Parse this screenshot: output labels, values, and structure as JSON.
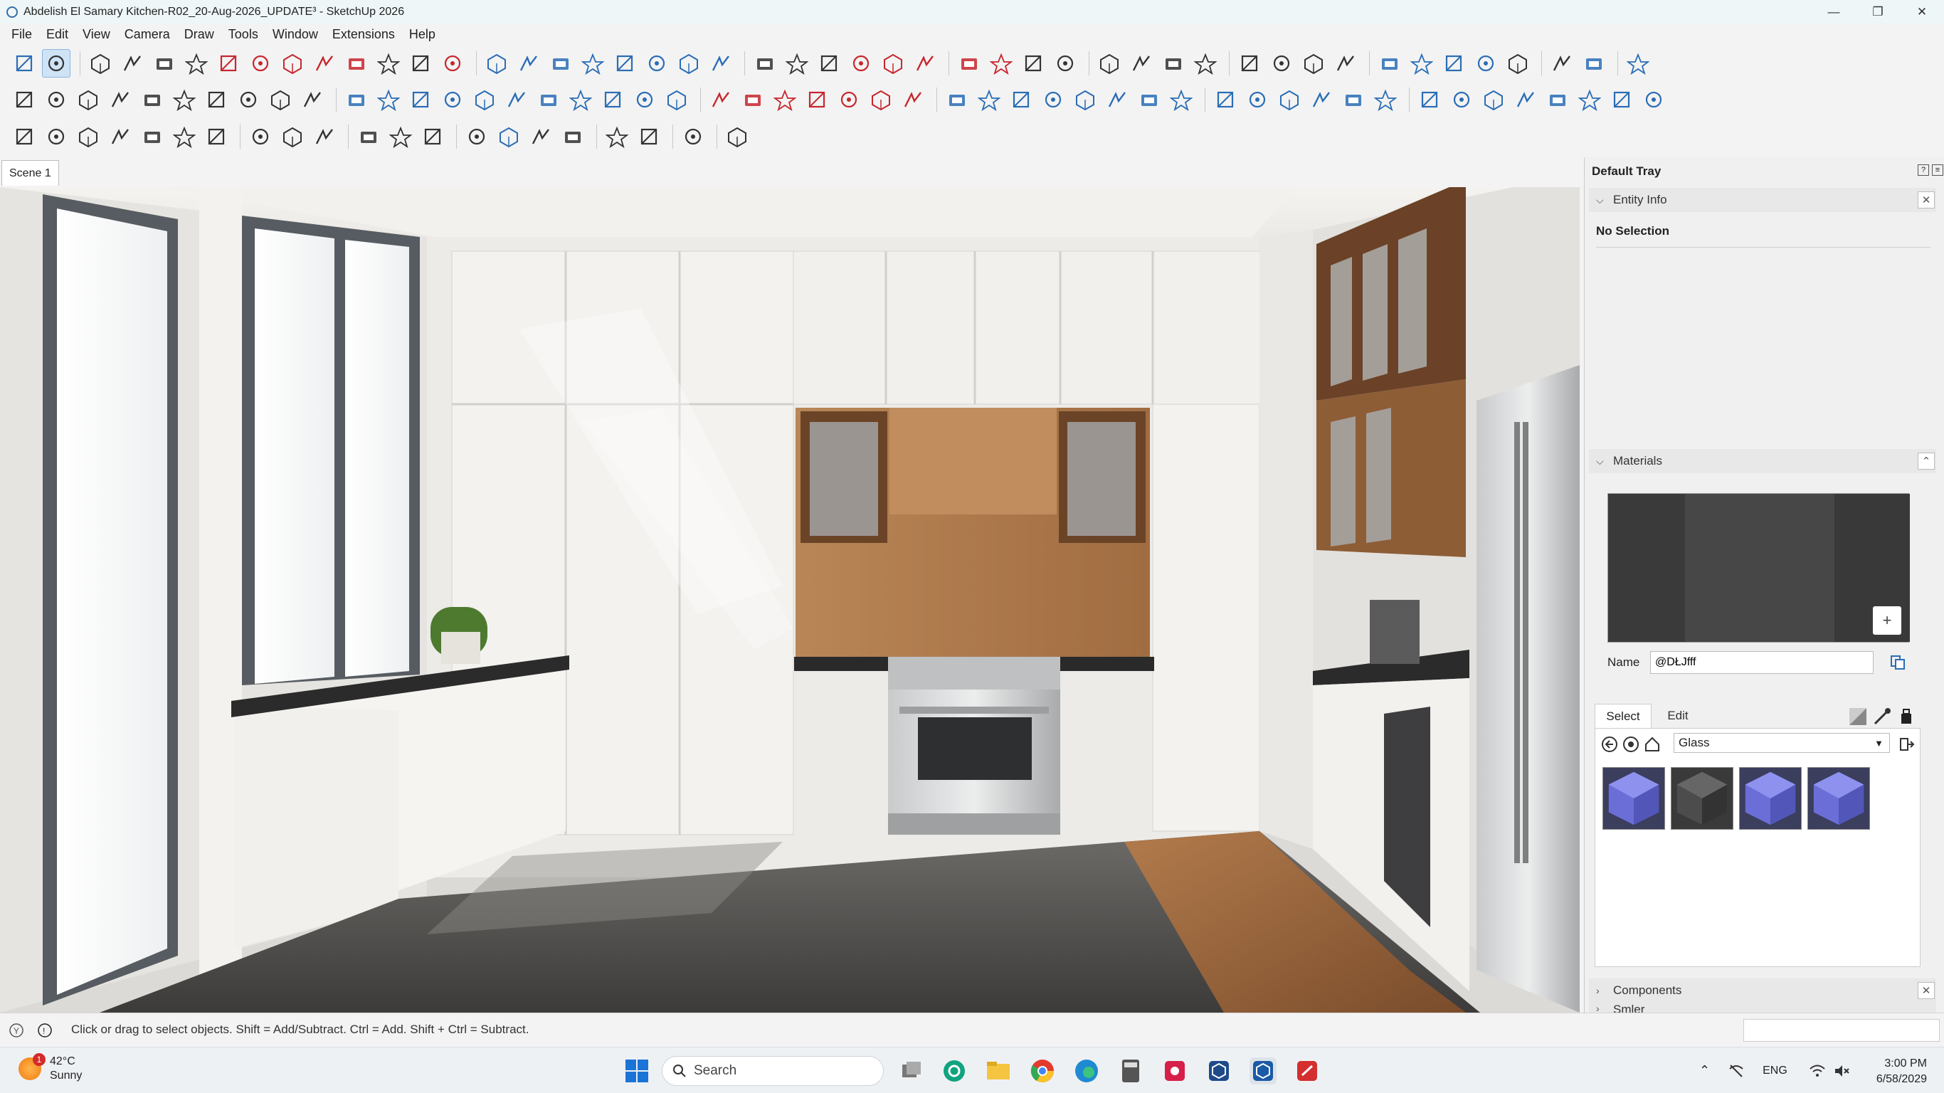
{
  "window": {
    "title": "Abdelish El Samary Kitchen-R02_20-Aug-2026_UPDATE³ - SketchUp 2026",
    "minimize": "—",
    "maximize": "❐",
    "close": "✕"
  },
  "menu": [
    "File",
    "Edit",
    "View",
    "Camera",
    "Draw",
    "Tools",
    "Window",
    "Extensions",
    "Help"
  ],
  "toolbar_icons": {
    "row1": [
      "zoom-icon",
      "select-icon",
      "eraser-icon",
      "pencil-icon",
      "line-icon",
      "rectangle-icon",
      "push-pull-icon",
      "follow-me-icon",
      "move-icon",
      "rotate-icon",
      "scale-icon",
      "offset-icon",
      "tape-icon",
      "paint-bucket-icon",
      "orbit-icon",
      "pan-icon",
      "zoom-extents-icon",
      "section-icon",
      "layers-icon",
      "styles-icon",
      "component-icon",
      "warehouse-icon",
      "folder-icon",
      "settings-icon",
      "close-icon",
      "drop-icon",
      "drop2-icon",
      "drop3-icon",
      "drop4-icon",
      "drop5-icon",
      "magnet-icon",
      "magnet2-icon",
      "box-icon",
      "box2-icon",
      "box3-icon",
      "box4-icon",
      "axes-icon",
      "axes2-icon",
      "plus-icon",
      "measure-icon",
      "solid-icon",
      "solid2-icon",
      "solid3-icon",
      "solid4-icon",
      "stack-icon",
      "page-icon",
      "users-icon",
      "extension-icon"
    ],
    "row2": [
      "draw-pencil-icon",
      "draw-curve-icon",
      "draw-rect-icon",
      "draw-rect2-icon",
      "draw-circle-icon",
      "draw-circle2-icon",
      "draw-arc-icon",
      "draw-arc2-icon",
      "draw-arc3-icon",
      "draw-arc4-icon",
      "shape-icon",
      "shape2-icon",
      "shape3-icon",
      "shape4-icon",
      "shape5-icon",
      "shape6-icon",
      "shape7-icon",
      "shape8-icon",
      "shape9-icon",
      "shape10-icon",
      "shape11-icon",
      "terrain-icon",
      "terrain2-icon",
      "terrain3-icon",
      "terrain4-icon",
      "terrain5-icon",
      "terrain6-icon",
      "terrain7-icon",
      "render-icon",
      "render2-icon",
      "render3-icon",
      "render4-icon",
      "render5-icon",
      "render6-icon",
      "render7-icon",
      "render8-icon",
      "copy-icon",
      "copy2-icon",
      "copy3-icon",
      "copy4-icon",
      "copy5-icon",
      "copy6-icon",
      "view-icon",
      "view2-icon",
      "view3-icon",
      "view4-icon",
      "view5-icon",
      "view6-icon",
      "view7-icon",
      "view8-icon"
    ],
    "row3": [
      "sandbox-icon",
      "cube-icon",
      "cube2-icon",
      "plant-icon",
      "pencil2-icon",
      "building-icon",
      "building2-icon",
      "grid-icon",
      "grid2-icon",
      "grid3-icon",
      "new-file-icon",
      "open-icon",
      "save-icon",
      "cut-icon",
      "copy7-icon",
      "paste-icon",
      "delete-icon",
      "undo-icon",
      "redo-icon",
      "print-icon",
      "info-icon"
    ]
  },
  "scene_tab": "Scene 1",
  "tray": {
    "title": "Default Tray",
    "entity_info": {
      "header": "Entity Info",
      "no_selection": "No Selection"
    },
    "materials": {
      "header": "Materials",
      "name_label": "Name",
      "name_value": "@DŁJfff",
      "tab_select": "Select",
      "tab_edit": "Edit",
      "library": "Glass",
      "swatches": [
        "glass-blue",
        "glass-dark",
        "glass-blue-2",
        "glass-blue-3"
      ]
    },
    "components": {
      "header": "Components"
    },
    "styles": {
      "header": "Smler"
    }
  },
  "status": {
    "message": "Click or drag to select objects. Shift = Add/Subtract. Ctrl = Add. Shift + Ctrl = Subtract."
  },
  "taskbar": {
    "weather_temp": "42°C",
    "weather_desc": "Sunny",
    "weather_badge": "1",
    "search_placeholder": "Search",
    "language": "ENG",
    "time": "3:00 PM",
    "date": "6/58/2029"
  },
  "colors": {
    "accent": "#2a6db5",
    "selection": "#cfe3f6",
    "tray_bg": "#f0f0f0"
  }
}
